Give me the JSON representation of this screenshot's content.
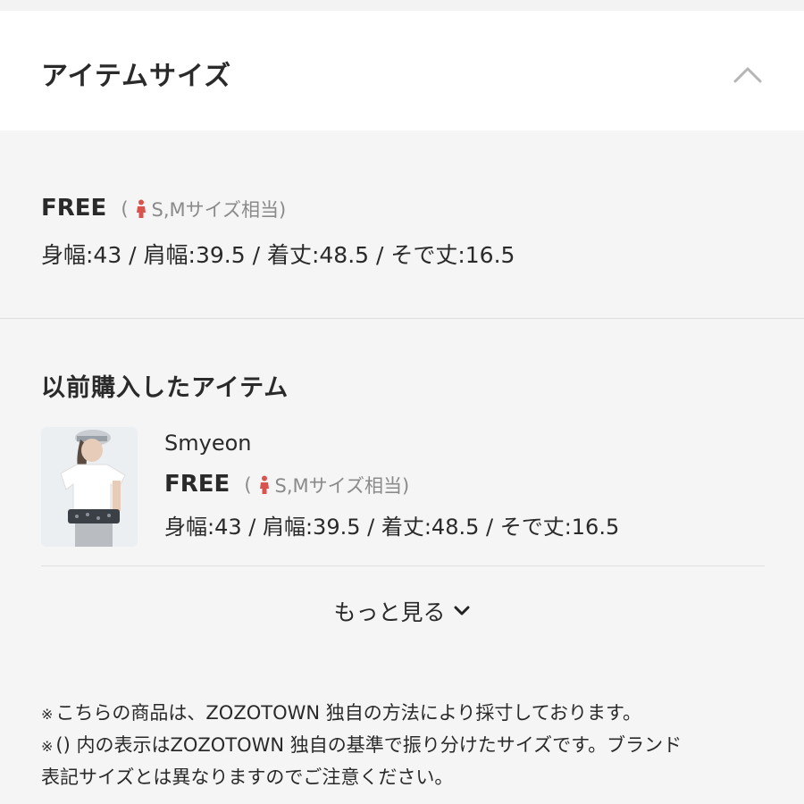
{
  "header": {
    "title": "アイテムサイズ"
  },
  "size": {
    "label": "FREE",
    "equiv_open": "(",
    "equiv_text": "S,Mサイズ相当)",
    "measurements": "身幅:43 / 肩幅:39.5 / 着丈:48.5 / そで丈:16.5"
  },
  "previous": {
    "title": "以前購入したアイテム",
    "item": {
      "brand": "Smyeon",
      "size_label": "FREE",
      "equiv_open": "(",
      "equiv_text": "S,Mサイズ相当)",
      "measurements": "身幅:43 / 肩幅:39.5 / 着丈:48.5 / そで丈:16.5"
    }
  },
  "more": {
    "label": "もっと見る"
  },
  "notes": {
    "mark": "※",
    "line1": "こちらの商品は、ZOZOTOWN 独自の方法により採寸しております。",
    "line2": "() 内の表示はZOZOTOWN 独自の基準で振り分けたサイズです。ブランド",
    "line3": "表記サイズとは異なりますのでご注意ください。"
  },
  "colors": {
    "accent_person": "#d9534f",
    "background": "#f5f5f5",
    "header_bg": "#ffffff"
  },
  "icons": {
    "collapse": "chevron-up-icon",
    "expand": "chevron-down-icon",
    "size_person": "person-icon"
  }
}
